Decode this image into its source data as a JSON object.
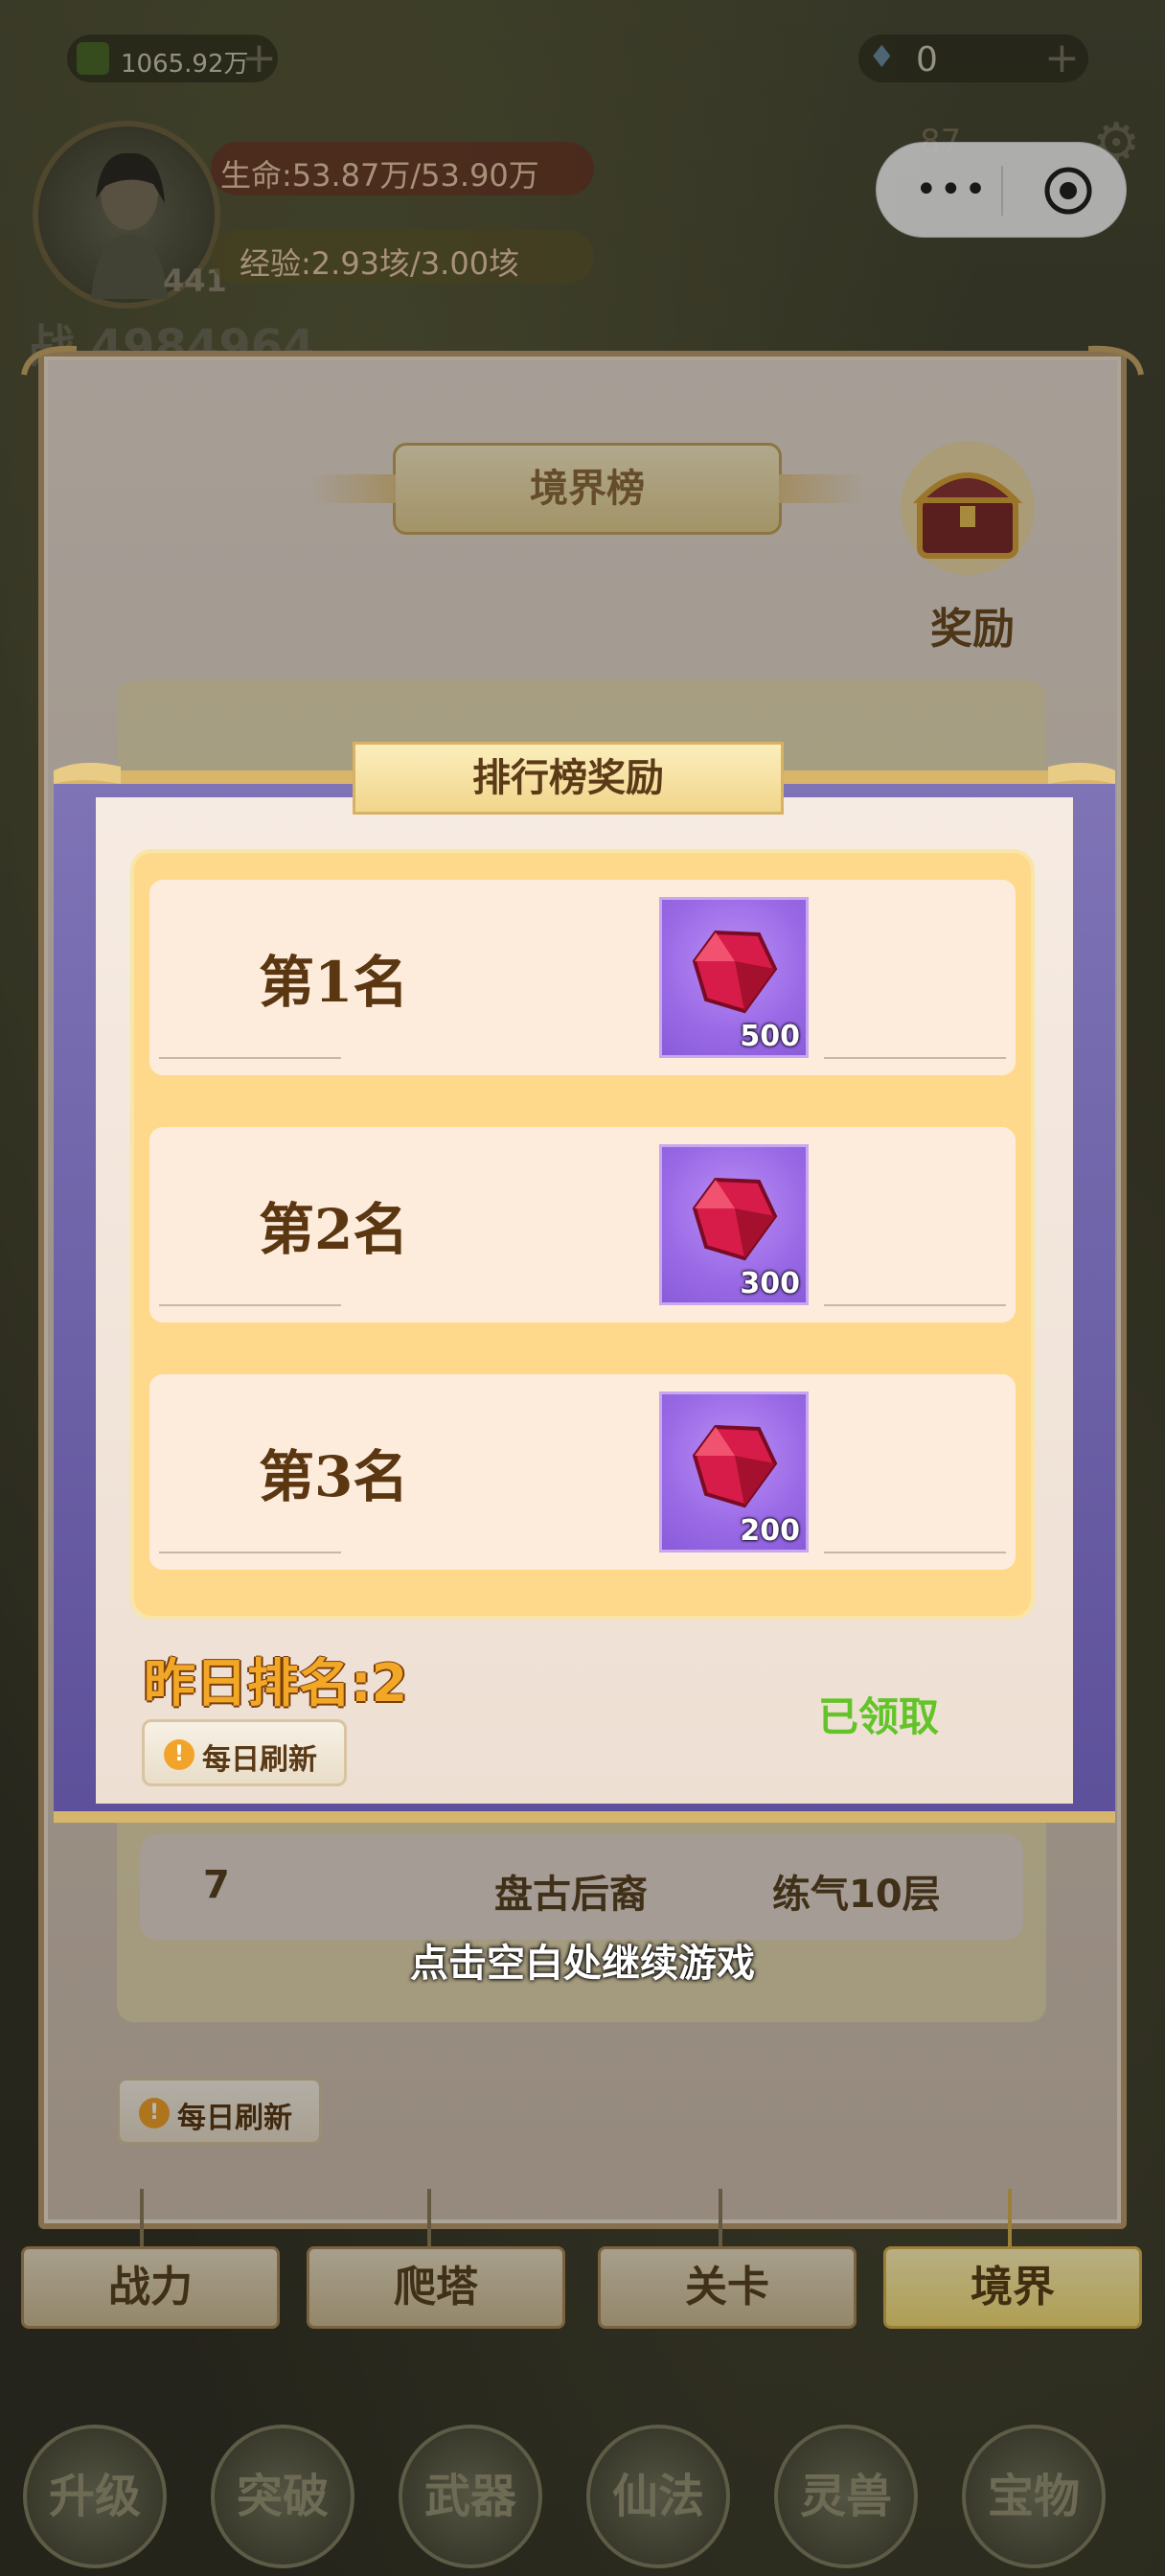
{
  "hud": {
    "currency_value": "1065.92万",
    "diamond_value": "0",
    "hp_text": "生命:53.87万/53.90万",
    "exp_text": "经验:2.93垓/3.00垓",
    "level": "441",
    "power_prefix": "战",
    "power_value": "4984964",
    "energy_value": "87"
  },
  "miniprogram_capsule": {
    "more_icon": "more-dots-icon",
    "close_icon": "target-circle-icon"
  },
  "leaderboard_panel": {
    "title": "境界榜",
    "reward_button_label": "奖励",
    "background_row": {
      "rank": "7",
      "name": "盘古后裔",
      "realm": "练气10层"
    },
    "refresh_label": "每日刷新"
  },
  "popup": {
    "title": "排行榜奖励",
    "rewards": [
      {
        "rank_label": "第1名",
        "item_icon": "red-gem-icon",
        "count": "500"
      },
      {
        "rank_label": "第2名",
        "item_icon": "red-gem-icon",
        "count": "300"
      },
      {
        "rank_label": "第3名",
        "item_icon": "red-gem-icon",
        "count": "200"
      }
    ],
    "yesterday_rank": "昨日排名:2",
    "claim_status": "已领取",
    "refresh_label": "每日刷新"
  },
  "continue_hint": "点击空白处继续游戏",
  "tabs": [
    {
      "label": "战力",
      "active": false
    },
    {
      "label": "爬塔",
      "active": false
    },
    {
      "label": "关卡",
      "active": false
    },
    {
      "label": "境界",
      "active": true
    }
  ],
  "action_bar": [
    "升级",
    "突破",
    "武器",
    "仙法",
    "灵兽",
    "宝物"
  ],
  "colors": {
    "popup_frame": "#6b5fa8",
    "reward_panel": "#ffd98b",
    "claimed_green": "#63c429",
    "yesterday_orange": "#f2a826"
  }
}
